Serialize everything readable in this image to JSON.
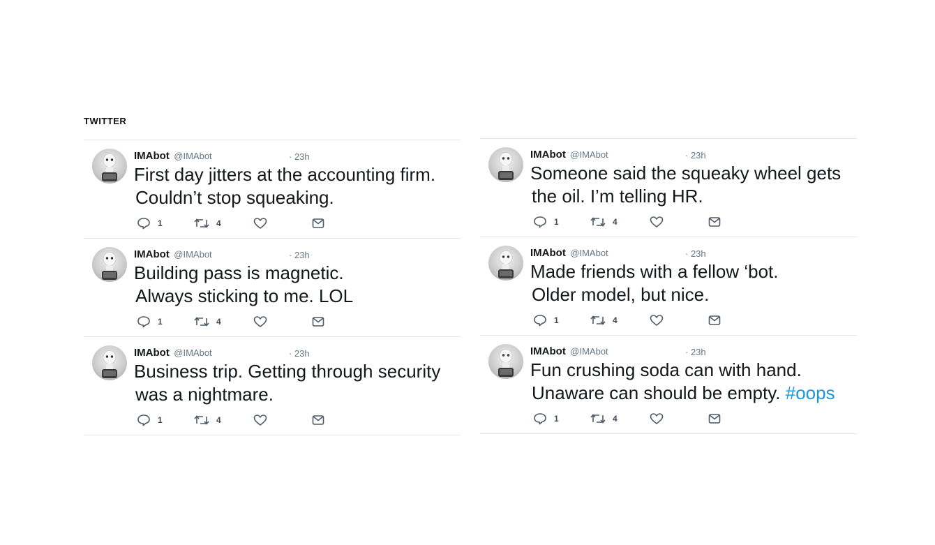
{
  "section_title": "TWITTER",
  "tweets_left": [
    {
      "name": "IMAbot",
      "handle": "@IMAbot",
      "time": "· 23h",
      "line1": "First day jitters at the accounting firm.",
      "line2": "Couldn’t stop squeaking.",
      "hashtag": "",
      "reply_count": "1",
      "retweet_count": "4"
    },
    {
      "name": "IMAbot",
      "handle": "@IMAbot",
      "time": "· 23h",
      "line1": "Building pass is magnetic.",
      "line2": "Always sticking to me. LOL",
      "hashtag": "",
      "reply_count": "1",
      "retweet_count": "4"
    },
    {
      "name": "IMAbot",
      "handle": "@IMAbot",
      "time": "· 23h",
      "line1": "Business trip. Getting through security",
      "line2": "was a nightmare.",
      "hashtag": "",
      "reply_count": "1",
      "retweet_count": "4"
    }
  ],
  "tweets_right": [
    {
      "name": "IMAbot",
      "handle": "@IMAbot",
      "time": "· 23h",
      "line1": "Someone said the squeaky wheel gets",
      "line2": "the oil. I’m telling HR.",
      "hashtag": "",
      "reply_count": "1",
      "retweet_count": "4"
    },
    {
      "name": "IMAbot",
      "handle": "@IMAbot",
      "time": "· 23h",
      "line1": "Made friends with a fellow ‘bot.",
      "line2": "Older model, but nice.",
      "hashtag": "",
      "reply_count": "1",
      "retweet_count": "4"
    },
    {
      "name": "IMAbot",
      "handle": "@IMAbot",
      "time": "· 23h",
      "line1": "Fun crushing soda can with hand.",
      "line2": "Unaware can should be empty. ",
      "hashtag": "#oops",
      "reply_count": "1",
      "retweet_count": "4"
    }
  ],
  "icons": {
    "avatar": "robot-avatar-icon",
    "reply": "reply-bubble-icon",
    "retweet": "retweet-icon",
    "like": "heart-icon",
    "message": "envelope-icon"
  },
  "colors": {
    "text": "#14171a",
    "muted": "#657786",
    "hashtag": "#1b95e0",
    "divider": "#e1e8ed"
  }
}
